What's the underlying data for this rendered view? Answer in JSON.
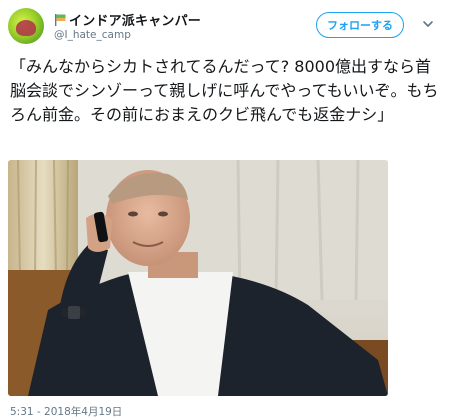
{
  "user": {
    "display_name": "インドア派キャンパー",
    "handle": "@I_hate_camp"
  },
  "actions": {
    "follow_label": "フォローする"
  },
  "tweet": {
    "text": "「みんなからシカトされてるんだって? 8000億出すなら首脳会談でシンゾーって親しげに呼んでやってもいいぞ。もちろん前金。その前におまえのクビ飛んでも返金ナシ」",
    "timestamp": "5:31 - 2018年4月19日"
  },
  "icons": {
    "avatar": "avatar-image",
    "flag": "flag-icon",
    "caret": "chevron-down-icon"
  },
  "colors": {
    "accent": "#1da1f2",
    "secondary_text": "#657786",
    "text": "#14171a"
  }
}
